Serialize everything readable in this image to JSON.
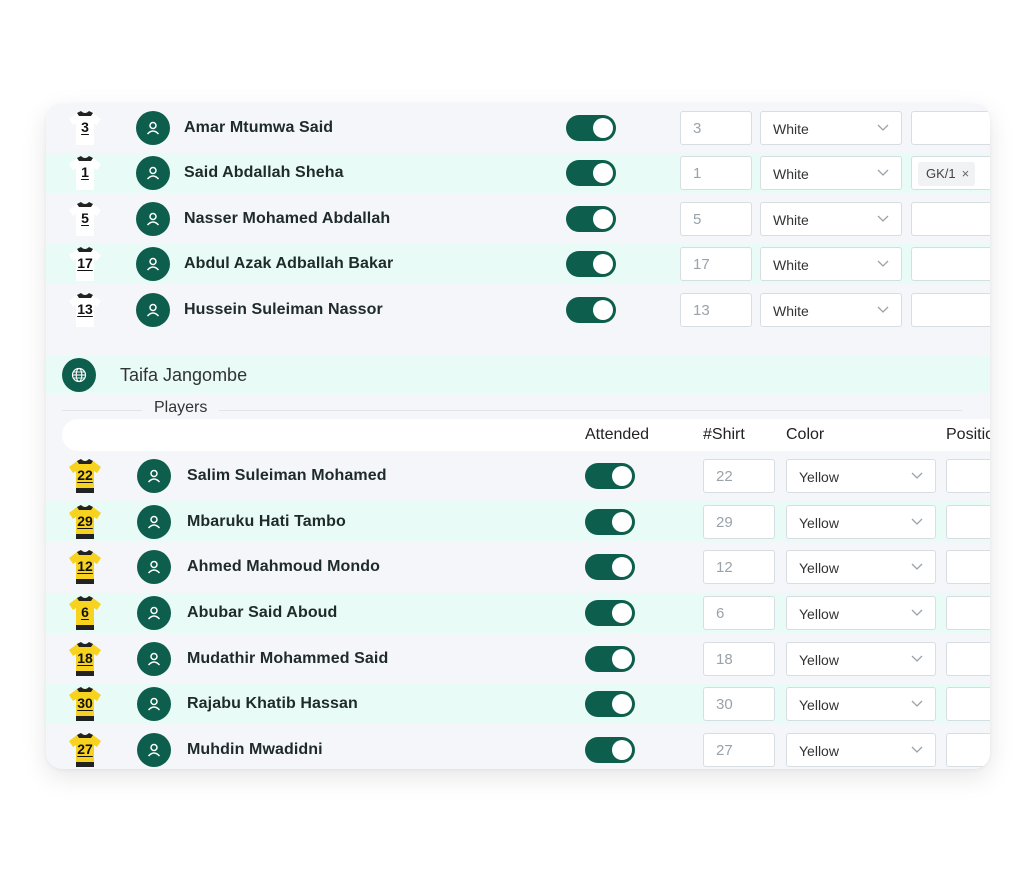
{
  "team_a": {
    "rows": [
      {
        "number": "3",
        "name": "Amar Mtumwa Said",
        "shirt_no": "3",
        "color": "White",
        "position_tag": ""
      },
      {
        "number": "1",
        "name": "Said Abdallah Sheha",
        "shirt_no": "1",
        "color": "White",
        "position_tag": "GK/1"
      },
      {
        "number": "5",
        "name": "Nasser Mohamed Abdallah",
        "shirt_no": "5",
        "color": "White",
        "position_tag": ""
      },
      {
        "number": "17",
        "name": "Abdul Azak Adballah Bakar",
        "shirt_no": "17",
        "color": "White",
        "position_tag": ""
      },
      {
        "number": "13",
        "name": "Hussein Suleiman Nassor",
        "shirt_no": "13",
        "color": "White",
        "position_tag": ""
      }
    ]
  },
  "team_b": {
    "name": "Taifa Jangombe",
    "players_label": "Players",
    "headers": {
      "attended": "Attended",
      "shirt": "#Shirt",
      "color": "Color",
      "position": "Positio"
    },
    "rows": [
      {
        "number": "22",
        "name": "Salim Suleiman Mohamed",
        "shirt_no": "22",
        "color": "Yellow"
      },
      {
        "number": "29",
        "name": "Mbaruku Hati Tambo",
        "shirt_no": "29",
        "color": "Yellow"
      },
      {
        "number": "12",
        "name": "Ahmed Mahmoud Mondo",
        "shirt_no": "12",
        "color": "Yellow"
      },
      {
        "number": "6",
        "name": "Abubar Said Aboud",
        "shirt_no": "6",
        "color": "Yellow"
      },
      {
        "number": "18",
        "name": "Mudathir Mohammed Said",
        "shirt_no": "18",
        "color": "Yellow"
      },
      {
        "number": "30",
        "name": "Rajabu Khatib Hassan",
        "shirt_no": "30",
        "color": "Yellow"
      },
      {
        "number": "27",
        "name": "Muhdin Mwadidni",
        "shirt_no": "27",
        "color": "Yellow"
      }
    ]
  },
  "colors": {
    "accent": "#0d5e4c",
    "row_alt": "#e9fbf7",
    "shirt_white": "#ffffff",
    "shirt_yellow": "#f7d31f"
  },
  "icons": {
    "avatar": "user-icon",
    "team": "globe-icon",
    "toggle": "attended-toggle",
    "select": "chevron-down-icon",
    "shirt": "shirt-icon"
  }
}
